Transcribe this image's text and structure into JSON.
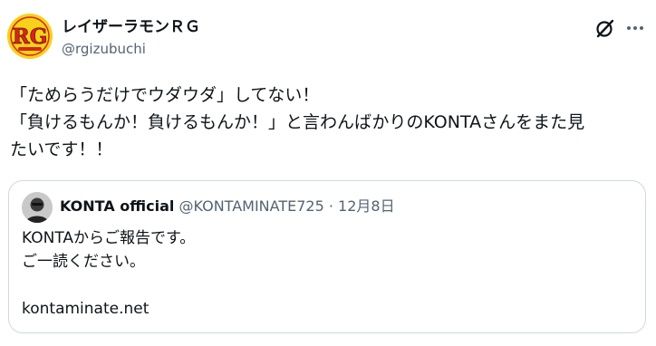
{
  "post": {
    "author": {
      "display_name": "レイザーラモンＲＧ",
      "handle": "@rgizubuchi",
      "avatar_text": "RG"
    },
    "text_lines": [
      "「ためらうだけでウダウダ」してない！",
      "「負けるもんか！負けるもんか！」と言わんばかりのKONTAさんをまた見",
      "たいです！！"
    ],
    "actions": {
      "grok_icon": "grok-icon",
      "more_icon": "more-options-icon"
    }
  },
  "quote": {
    "author_name": "KONTA official",
    "author_handle": "@KONTAMINATE725",
    "separator": "·",
    "date": "12月8日",
    "text_lines": [
      "KONTAからご報告です。",
      "ご一読ください。",
      "",
      "kontaminate.net"
    ]
  },
  "colors": {
    "text_primary": "#0f1419",
    "text_secondary": "#536471",
    "border": "#cfd9de",
    "avatar_yellow": "#f6d21a",
    "avatar_red": "#d7261e"
  }
}
